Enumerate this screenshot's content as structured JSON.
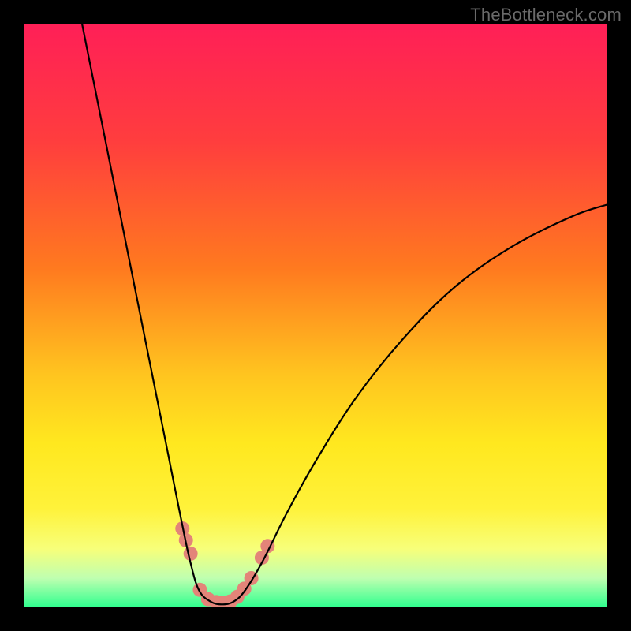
{
  "watermark": "TheBottleneck.com",
  "colors": {
    "frame": "#000000",
    "watermark": "#6a6a6a",
    "gradient_stops": [
      {
        "offset": 0.0,
        "color": "#ff1f57"
      },
      {
        "offset": 0.2,
        "color": "#ff3d3e"
      },
      {
        "offset": 0.42,
        "color": "#ff7a1f"
      },
      {
        "offset": 0.6,
        "color": "#ffc41f"
      },
      {
        "offset": 0.72,
        "color": "#ffe81f"
      },
      {
        "offset": 0.83,
        "color": "#fff23a"
      },
      {
        "offset": 0.9,
        "color": "#f7ff7a"
      },
      {
        "offset": 0.95,
        "color": "#bfffb0"
      },
      {
        "offset": 1.0,
        "color": "#2fff8f"
      }
    ],
    "curve": "#000000",
    "dots": "#e38479"
  },
  "chart_data": {
    "type": "line",
    "title": "",
    "xlabel": "",
    "ylabel": "",
    "xlim": [
      0,
      100
    ],
    "ylim": [
      0,
      100
    ],
    "grid": false,
    "curve": [
      {
        "x": 10,
        "y": 100
      },
      {
        "x": 14,
        "y": 80
      },
      {
        "x": 18,
        "y": 60
      },
      {
        "x": 22,
        "y": 40
      },
      {
        "x": 25,
        "y": 25
      },
      {
        "x": 27,
        "y": 15
      },
      {
        "x": 28.5,
        "y": 8
      },
      {
        "x": 30,
        "y": 3
      },
      {
        "x": 32,
        "y": 1
      },
      {
        "x": 34,
        "y": 0.5
      },
      {
        "x": 36,
        "y": 1
      },
      {
        "x": 38,
        "y": 3
      },
      {
        "x": 41,
        "y": 8
      },
      {
        "x": 45,
        "y": 16
      },
      {
        "x": 50,
        "y": 25
      },
      {
        "x": 57,
        "y": 36
      },
      {
        "x": 65,
        "y": 46
      },
      {
        "x": 74,
        "y": 55
      },
      {
        "x": 84,
        "y": 62
      },
      {
        "x": 94,
        "y": 67
      },
      {
        "x": 100,
        "y": 69
      }
    ],
    "dots": [
      {
        "x": 27.2,
        "y": 13.5
      },
      {
        "x": 27.8,
        "y": 11.5
      },
      {
        "x": 28.6,
        "y": 9.2
      },
      {
        "x": 30.2,
        "y": 3.0
      },
      {
        "x": 31.6,
        "y": 1.4
      },
      {
        "x": 33.0,
        "y": 0.9
      },
      {
        "x": 34.2,
        "y": 0.8
      },
      {
        "x": 35.4,
        "y": 1.0
      },
      {
        "x": 36.6,
        "y": 1.8
      },
      {
        "x": 37.8,
        "y": 3.2
      },
      {
        "x": 39.0,
        "y": 5.0
      },
      {
        "x": 40.8,
        "y": 8.5
      },
      {
        "x": 41.8,
        "y": 10.5
      }
    ]
  }
}
